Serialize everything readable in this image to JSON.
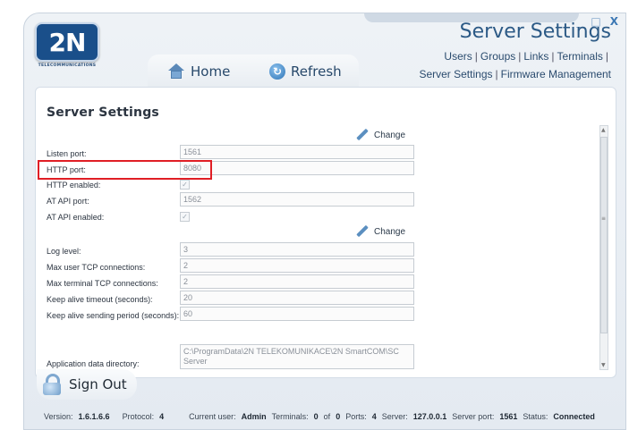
{
  "window": {
    "title": "Server Settings",
    "controls": {
      "minimize": "_",
      "maximize": "□",
      "close": "X"
    }
  },
  "logo": {
    "mark": "2N",
    "subtitle": "TELECOMMUNICATIONS"
  },
  "topnav": {
    "links": [
      "Users",
      "Groups",
      "Links",
      "Terminals",
      "Server Settings",
      "Firmware Management"
    ],
    "separator": "|"
  },
  "navbar": {
    "home_label": "Home",
    "refresh_label": "Refresh"
  },
  "panel": {
    "title": "Server Settings",
    "change_label": "Change",
    "section1": [
      {
        "label": "Listen port:",
        "value": "1561",
        "type": "text"
      },
      {
        "label": "HTTP port:",
        "value": "8080",
        "type": "text"
      },
      {
        "label": "HTTP enabled:",
        "value": "✓",
        "type": "check"
      },
      {
        "label": "AT API port:",
        "value": "1562",
        "type": "text"
      },
      {
        "label": "AT API enabled:",
        "value": "✓",
        "type": "check"
      }
    ],
    "section2": [
      {
        "label": "Log level:",
        "value": "3"
      },
      {
        "label": "Max user TCP connections:",
        "value": "2"
      },
      {
        "label": "Max terminal TCP connections:",
        "value": "2"
      },
      {
        "label": "Keep alive timeout (seconds):",
        "value": "20"
      },
      {
        "label": "Keep alive sending period (seconds):",
        "value": "60"
      }
    ],
    "app_dir": {
      "label": "Application data directory:",
      "line1": "C:\\ProgramData\\2N TELEKOMUNIKACE\\2N SmartCOM\\SC",
      "line2": "Server"
    }
  },
  "signout": {
    "label": "Sign Out"
  },
  "status": {
    "version_label": "Version:",
    "version": "1.6.1.6.6",
    "protocol_label": "Protocol:",
    "protocol": "4",
    "user_label": "Current user:",
    "user": "Admin",
    "terminals_label": "Terminals:",
    "terminals_a": "0",
    "of": "of",
    "terminals_b": "0",
    "ports_label": "Ports:",
    "ports": "4",
    "server_label": "Server:",
    "server": "127.0.0.1",
    "server_port_label": "Server port:",
    "server_port": "1561",
    "status_label": "Status:",
    "status": "Connected"
  },
  "colors": {
    "accent": "#2c5a86",
    "highlight": "#e01e25",
    "brand": "#1a4f8a"
  }
}
